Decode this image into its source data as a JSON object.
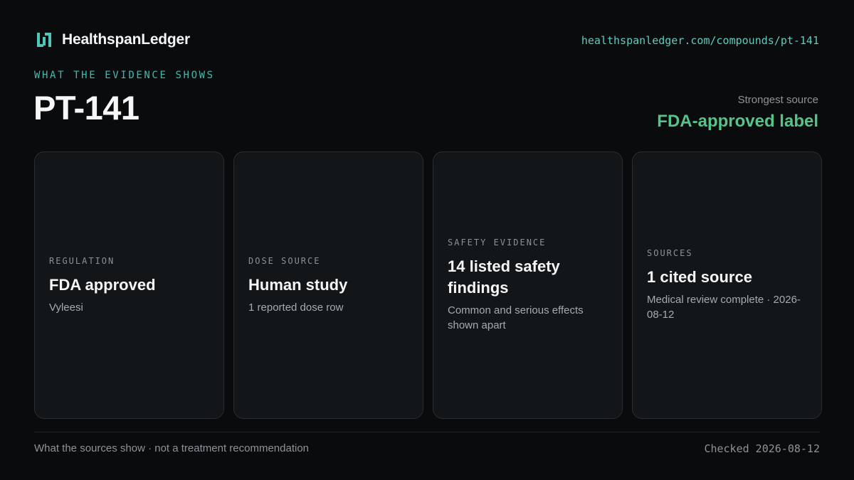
{
  "brand": {
    "name": "HealthspanLedger",
    "logo_icon": "ledger-h-icon",
    "accent_color": "#4fc7b8"
  },
  "url": "healthspanledger.com/compounds/pt-141",
  "eyebrow": "WHAT THE EVIDENCE SHOWS",
  "title": "PT-141",
  "strongest_source": {
    "label": "Strongest source",
    "value": "FDA-approved label",
    "color": "#56c48a"
  },
  "cards": [
    {
      "label": "REGULATION",
      "value": "FDA approved",
      "sub": "Vyleesi"
    },
    {
      "label": "DOSE SOURCE",
      "value": "Human study",
      "sub": "1 reported dose row"
    },
    {
      "label": "SAFETY EVIDENCE",
      "value": "14 listed safety findings",
      "sub": "Common and serious effects shown apart"
    },
    {
      "label": "SOURCES",
      "value": "1 cited source",
      "sub": "Medical review complete · 2026-08-12"
    }
  ],
  "footer": {
    "disclaimer": "What the sources show · not a treatment recommendation",
    "checked": "Checked 2026-08-12"
  }
}
